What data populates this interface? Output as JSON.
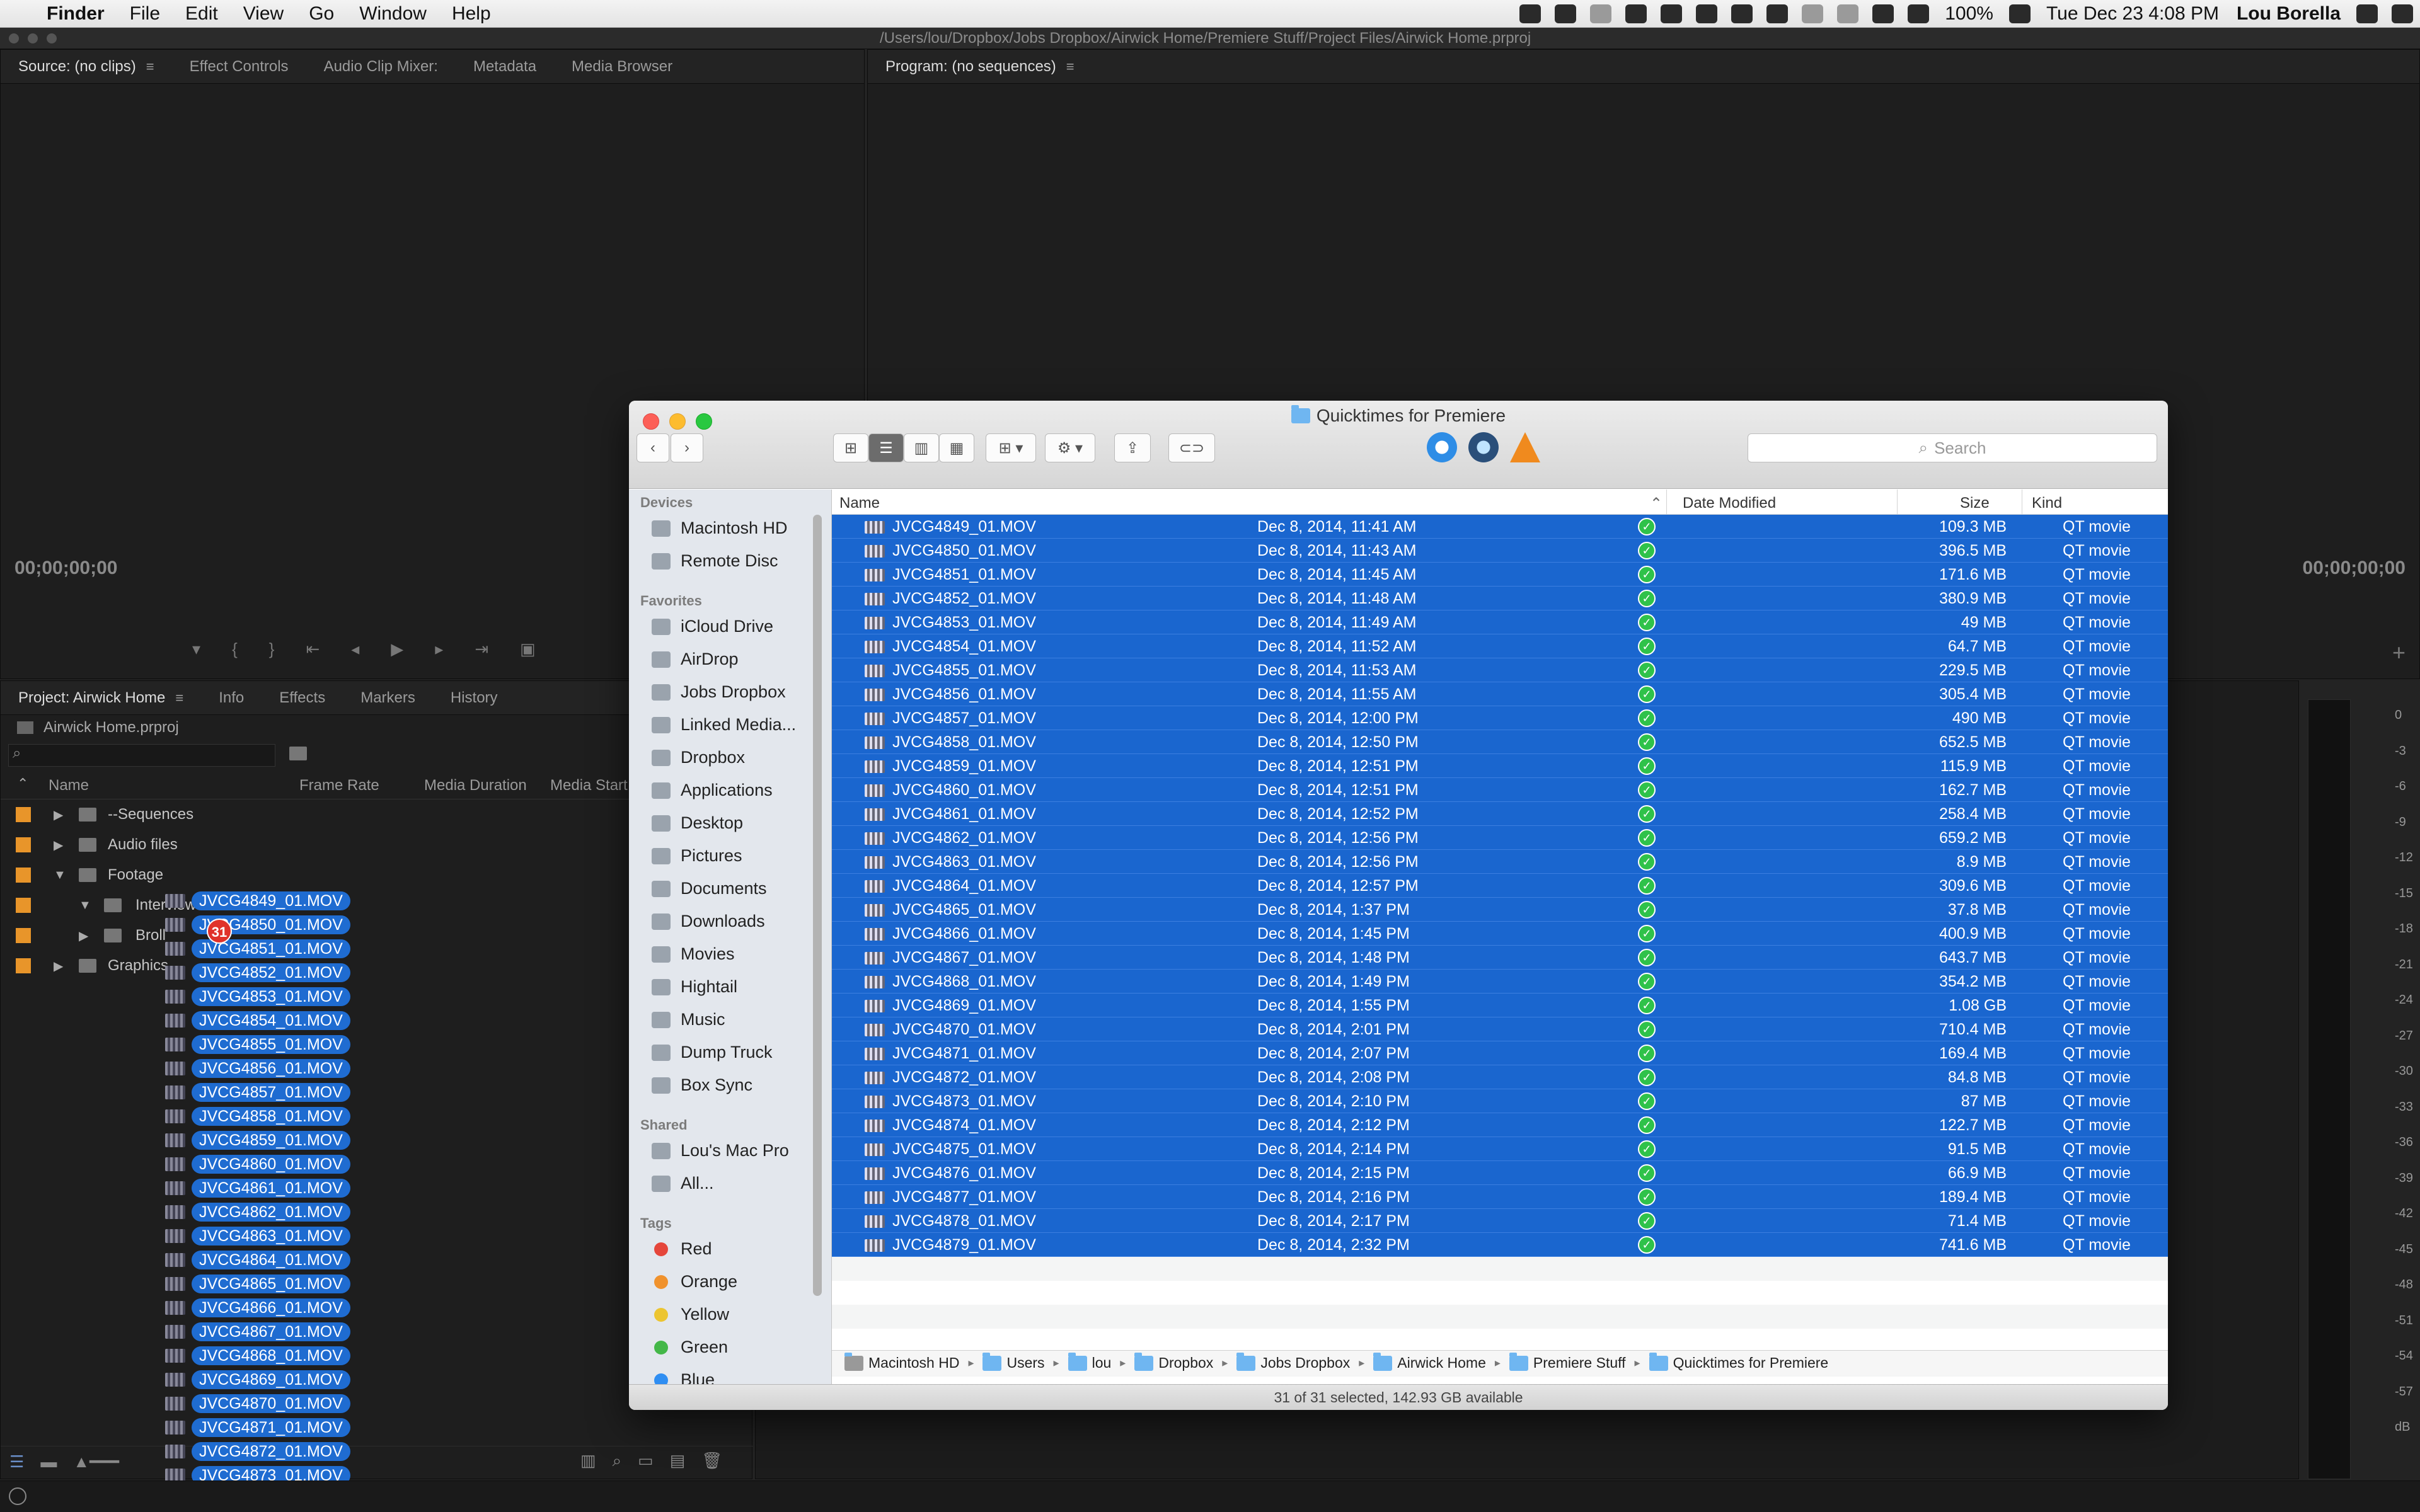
{
  "menubar": {
    "app": "Finder",
    "items": [
      "File",
      "Edit",
      "View",
      "Go",
      "Window",
      "Help"
    ],
    "battery": "100%",
    "clock": "Tue Dec 23  4:08 PM",
    "user": "Lou Borella"
  },
  "premiere": {
    "project_path": "/Users/lou/Dropbox/Jobs Dropbox/Airwick Home/Premiere Stuff/Project Files/Airwick Home.prproj",
    "source_tabs": [
      "Source: (no clips)",
      "Effect Controls",
      "Audio Clip Mixer:",
      "Metadata",
      "Media Browser"
    ],
    "program_tab": "Program: (no sequences)",
    "timecode_source": "00;00;00;00",
    "timecode_program": "00;00;00;00",
    "project_tabs": [
      "Project: Airwick Home",
      "Info",
      "Effects",
      "Markers",
      "History"
    ],
    "project_file": "Airwick Home.prproj",
    "columns": [
      "Name",
      "Frame Rate",
      "Media Duration",
      "Media Start"
    ],
    "bins": [
      {
        "name": "--Sequences",
        "expanded": false
      },
      {
        "name": "Audio files",
        "expanded": false
      },
      {
        "name": "Footage",
        "expanded": true
      },
      {
        "name": "Interviews",
        "expanded": true
      },
      {
        "name": "Broll",
        "expanded": false
      },
      {
        "name": "Graphics",
        "expanded": false
      }
    ],
    "drag_count": "31",
    "db_scale": [
      "0",
      "-3",
      "-6",
      "-9",
      "-12",
      "-15",
      "-18",
      "-21",
      "-24",
      "-27",
      "-30",
      "-33",
      "-36",
      "-39",
      "-42",
      "-45",
      "-48",
      "-51",
      "-54",
      "-57",
      "dB"
    ]
  },
  "finder": {
    "title": "Quicktimes for Premiere",
    "search_placeholder": "Search",
    "sidebar": {
      "devices_header": "Devices",
      "devices": [
        "Macintosh HD",
        "Remote Disc"
      ],
      "favorites_header": "Favorites",
      "favorites": [
        "iCloud Drive",
        "AirDrop",
        "Jobs Dropbox",
        "Linked Media...",
        "Dropbox",
        "Applications",
        "Desktop",
        "Pictures",
        "Documents",
        "Downloads",
        "Movies",
        "Hightail",
        "Music",
        "Dump Truck",
        "Box Sync"
      ],
      "shared_header": "Shared",
      "shared": [
        "Lou's Mac Pro",
        "All..."
      ],
      "tags_header": "Tags",
      "tags": [
        {
          "name": "Red",
          "color": "#e5463b"
        },
        {
          "name": "Orange",
          "color": "#f0922d"
        },
        {
          "name": "Yellow",
          "color": "#ecc531"
        },
        {
          "name": "Green",
          "color": "#43b748"
        },
        {
          "name": "Blue",
          "color": "#2f8ef2"
        }
      ]
    },
    "columns": {
      "name": "Name",
      "date": "Date Modified",
      "size": "Size",
      "kind": "Kind"
    },
    "files": [
      {
        "name": "JVCG4849_01.MOV",
        "date": "Dec 8, 2014, 11:41 AM",
        "size": "109.3 MB",
        "kind": "QT movie"
      },
      {
        "name": "JVCG4850_01.MOV",
        "date": "Dec 8, 2014, 11:43 AM",
        "size": "396.5 MB",
        "kind": "QT movie"
      },
      {
        "name": "JVCG4851_01.MOV",
        "date": "Dec 8, 2014, 11:45 AM",
        "size": "171.6 MB",
        "kind": "QT movie"
      },
      {
        "name": "JVCG4852_01.MOV",
        "date": "Dec 8, 2014, 11:48 AM",
        "size": "380.9 MB",
        "kind": "QT movie"
      },
      {
        "name": "JVCG4853_01.MOV",
        "date": "Dec 8, 2014, 11:49 AM",
        "size": "49 MB",
        "kind": "QT movie"
      },
      {
        "name": "JVCG4854_01.MOV",
        "date": "Dec 8, 2014, 11:52 AM",
        "size": "64.7 MB",
        "kind": "QT movie"
      },
      {
        "name": "JVCG4855_01.MOV",
        "date": "Dec 8, 2014, 11:53 AM",
        "size": "229.5 MB",
        "kind": "QT movie"
      },
      {
        "name": "JVCG4856_01.MOV",
        "date": "Dec 8, 2014, 11:55 AM",
        "size": "305.4 MB",
        "kind": "QT movie"
      },
      {
        "name": "JVCG4857_01.MOV",
        "date": "Dec 8, 2014, 12:00 PM",
        "size": "490 MB",
        "kind": "QT movie"
      },
      {
        "name": "JVCG4858_01.MOV",
        "date": "Dec 8, 2014, 12:50 PM",
        "size": "652.5 MB",
        "kind": "QT movie"
      },
      {
        "name": "JVCG4859_01.MOV",
        "date": "Dec 8, 2014, 12:51 PM",
        "size": "115.9 MB",
        "kind": "QT movie"
      },
      {
        "name": "JVCG4860_01.MOV",
        "date": "Dec 8, 2014, 12:51 PM",
        "size": "162.7 MB",
        "kind": "QT movie"
      },
      {
        "name": "JVCG4861_01.MOV",
        "date": "Dec 8, 2014, 12:52 PM",
        "size": "258.4 MB",
        "kind": "QT movie"
      },
      {
        "name": "JVCG4862_01.MOV",
        "date": "Dec 8, 2014, 12:56 PM",
        "size": "659.2 MB",
        "kind": "QT movie"
      },
      {
        "name": "JVCG4863_01.MOV",
        "date": "Dec 8, 2014, 12:56 PM",
        "size": "8.9 MB",
        "kind": "QT movie"
      },
      {
        "name": "JVCG4864_01.MOV",
        "date": "Dec 8, 2014, 12:57 PM",
        "size": "309.6 MB",
        "kind": "QT movie"
      },
      {
        "name": "JVCG4865_01.MOV",
        "date": "Dec 8, 2014, 1:37 PM",
        "size": "37.8 MB",
        "kind": "QT movie"
      },
      {
        "name": "JVCG4866_01.MOV",
        "date": "Dec 8, 2014, 1:45 PM",
        "size": "400.9 MB",
        "kind": "QT movie"
      },
      {
        "name": "JVCG4867_01.MOV",
        "date": "Dec 8, 2014, 1:48 PM",
        "size": "643.7 MB",
        "kind": "QT movie"
      },
      {
        "name": "JVCG4868_01.MOV",
        "date": "Dec 8, 2014, 1:49 PM",
        "size": "354.2 MB",
        "kind": "QT movie"
      },
      {
        "name": "JVCG4869_01.MOV",
        "date": "Dec 8, 2014, 1:55 PM",
        "size": "1.08 GB",
        "kind": "QT movie"
      },
      {
        "name": "JVCG4870_01.MOV",
        "date": "Dec 8, 2014, 2:01 PM",
        "size": "710.4 MB",
        "kind": "QT movie"
      },
      {
        "name": "JVCG4871_01.MOV",
        "date": "Dec 8, 2014, 2:07 PM",
        "size": "169.4 MB",
        "kind": "QT movie"
      },
      {
        "name": "JVCG4872_01.MOV",
        "date": "Dec 8, 2014, 2:08 PM",
        "size": "84.8 MB",
        "kind": "QT movie"
      },
      {
        "name": "JVCG4873_01.MOV",
        "date": "Dec 8, 2014, 2:10 PM",
        "size": "87 MB",
        "kind": "QT movie"
      },
      {
        "name": "JVCG4874_01.MOV",
        "date": "Dec 8, 2014, 2:12 PM",
        "size": "122.7 MB",
        "kind": "QT movie"
      },
      {
        "name": "JVCG4875_01.MOV",
        "date": "Dec 8, 2014, 2:14 PM",
        "size": "91.5 MB",
        "kind": "QT movie"
      },
      {
        "name": "JVCG4876_01.MOV",
        "date": "Dec 8, 2014, 2:15 PM",
        "size": "66.9 MB",
        "kind": "QT movie"
      },
      {
        "name": "JVCG4877_01.MOV",
        "date": "Dec 8, 2014, 2:16 PM",
        "size": "189.4 MB",
        "kind": "QT movie"
      },
      {
        "name": "JVCG4878_01.MOV",
        "date": "Dec 8, 2014, 2:17 PM",
        "size": "71.4 MB",
        "kind": "QT movie"
      },
      {
        "name": "JVCG4879_01.MOV",
        "date": "Dec 8, 2014, 2:32 PM",
        "size": "741.6 MB",
        "kind": "QT movie"
      }
    ],
    "path": [
      "Macintosh HD",
      "Users",
      "lou",
      "Dropbox",
      "Jobs Dropbox",
      "Airwick Home",
      "Premiere Stuff",
      "Quicktimes for Premiere"
    ],
    "status": "31 of 31 selected, 142.93 GB available"
  }
}
